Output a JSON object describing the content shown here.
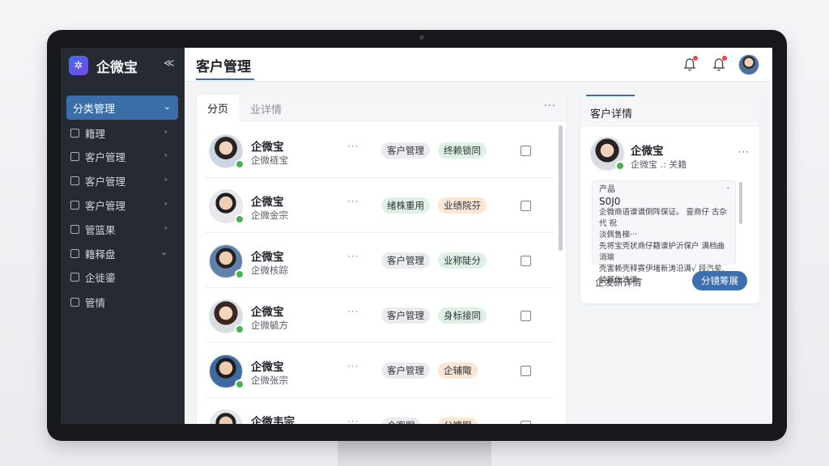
{
  "app": {
    "name": "企微宝",
    "logo_glyph": "✲",
    "collapse_glyph": "≪"
  },
  "sidebar": {
    "active": {
      "label": "分类管理",
      "chevron": "⌄"
    },
    "items": [
      {
        "label": "籍理",
        "chevron": "›"
      },
      {
        "label": "客户管理",
        "chevron": "›"
      },
      {
        "label": "客户管理",
        "chevron": "›"
      },
      {
        "label": "客户管理",
        "chevron": "›"
      },
      {
        "label": "管篮果",
        "chevron": "›"
      },
      {
        "label": "籍释盘",
        "chevron": "⌄"
      },
      {
        "label": "企徙鎏",
        "chevron": ""
      },
      {
        "label": "管情",
        "chevron": ""
      }
    ]
  },
  "header": {
    "title": "客户管理",
    "icons": [
      "bell-icon",
      "bell-icon",
      "avatar"
    ]
  },
  "list": {
    "tabs": [
      {
        "label": "分页"
      },
      {
        "label": "业详情"
      }
    ],
    "more": "···",
    "rows": [
      {
        "name": "企微宝",
        "sub": "企微裢宝",
        "dots": "···",
        "tags": [
          {
            "label": "客户管理",
            "tone": "gray"
          },
          {
            "label": "终赖锁同",
            "tone": "green"
          }
        ],
        "avatar": "woman"
      },
      {
        "name": "企微宝",
        "sub": "企微金宗",
        "dots": "···",
        "tags": [
          {
            "label": "绪株重用",
            "tone": "green"
          },
          {
            "label": "业绩院芬",
            "tone": "orange"
          }
        ],
        "avatar": "man"
      },
      {
        "name": "企微宝",
        "sub": "企微核踪",
        "dots": "···",
        "tags": [
          {
            "label": "客户管理",
            "tone": "gray"
          },
          {
            "label": "业称陡分",
            "tone": "green"
          }
        ],
        "avatar": "man2"
      },
      {
        "name": "企微宝",
        "sub": "企微毓方",
        "dots": "···",
        "tags": [
          {
            "label": "客户管理",
            "tone": "gray"
          },
          {
            "label": "身标接同",
            "tone": "green"
          }
        ],
        "avatar": "woman2"
      },
      {
        "name": "企微宝",
        "sub": "企微张宗",
        "dots": "···",
        "tags": [
          {
            "label": "客户管理",
            "tone": "gray"
          },
          {
            "label": "企辅陬",
            "tone": "orange"
          }
        ],
        "avatar": "man"
      },
      {
        "name": "企微韦宗",
        "sub": "",
        "dots": "···",
        "tags": [
          {
            "label": "企客服",
            "tone": "gray"
          },
          {
            "label": "分馈服",
            "tone": "orange"
          }
        ],
        "avatar": "man2"
      }
    ]
  },
  "detail": {
    "title": "客户详情",
    "name": "企微宝",
    "sub": "企微宝 .: 关籍",
    "more": "···",
    "note_label": "产晶",
    "note_edit": "ˆ",
    "amount": "S0J0",
    "note_lines": [
      "企微商语谱谱倒阵保证。 壹商仔 古杂代 祝",
      "淡佩售梯···",
      "先将宝壳状商仔籍谱护沂保户 满档曲消瑜",
      "壳害赖壳释赛伊堵新涛沿满√ 段汽矣.",
      "装器佐浅谱··"
    ],
    "link": "企发研详情",
    "button": "分镜筹展"
  },
  "colors": {
    "sidebar_bg": "#262b33",
    "accent": "#3b6fb0",
    "online": "#4caf50",
    "alert": "#ef4444"
  }
}
